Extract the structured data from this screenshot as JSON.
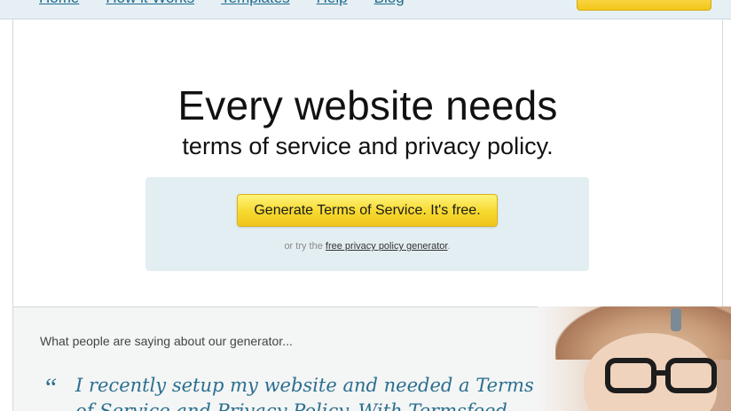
{
  "nav": {
    "items": [
      "Home",
      "How it Works",
      "Templates",
      "Help",
      "Blog"
    ],
    "signup_label": ""
  },
  "hero": {
    "title": "Every website needs",
    "subtitle": "terms of service and privacy policy."
  },
  "cta": {
    "button_label": "Generate Terms of Service. It's free.",
    "alt_prefix": "or try the ",
    "alt_link": "free privacy policy generator",
    "alt_suffix": "."
  },
  "testimonials": {
    "heading": "What people are saying about our generator...",
    "quote_mark": "“",
    "quote": "I recently setup my website and needed a Terms of Service and Privacy Policy. With Termsfeed"
  },
  "colors": {
    "accent": "#2a6f8f",
    "nav_bg": "#e6f0f4",
    "cta_box_bg": "#e3eef3",
    "button_yellow": "#f6d92f"
  }
}
